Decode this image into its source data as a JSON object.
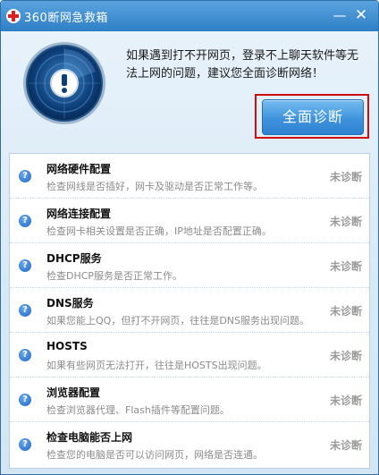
{
  "window": {
    "title": "360断网急救箱",
    "minimize_glyph": "—",
    "close_glyph": "✕"
  },
  "header": {
    "message": "如果遇到打不开网页，登录不上聊天软件等无法上网的问题，建议您全面诊断网络！",
    "scan_button": "全面诊断"
  },
  "items": [
    {
      "title": "网络硬件配置",
      "desc": "检查网线是否插好，网卡及驱动是否正常工作等。",
      "status": "未诊断"
    },
    {
      "title": "网络连接配置",
      "desc": "检查网卡相关设置是否正确，IP地址是否配置正确。",
      "status": "未诊断"
    },
    {
      "title": "DHCP服务",
      "desc": "检查DHCP服务是否正常工作。",
      "status": "未诊断"
    },
    {
      "title": "DNS服务",
      "desc": "如果您能上QQ，但打不开网页，往往是DNS服务出现问题。",
      "status": "未诊断"
    },
    {
      "title": "HOSTS",
      "desc": "如果有些网页无法打开，往往是HOSTS出现问题。",
      "status": "未诊断"
    },
    {
      "title": "浏览器配置",
      "desc": "检查浏览器代理、Flash插件等配置问题。",
      "status": "未诊断"
    },
    {
      "title": "检查电脑能否上网",
      "desc": "检查您的电脑是否可以访问网页，网络是否连通。",
      "status": "未诊断"
    }
  ],
  "icons": {
    "app": "red-cross-icon",
    "row": "question-mark-icon",
    "radar": "radar-alert-icon"
  },
  "colors": {
    "titlebar": "#2f7fc6",
    "highlight_border": "#d10c0c",
    "status": "#9a9a9a"
  }
}
